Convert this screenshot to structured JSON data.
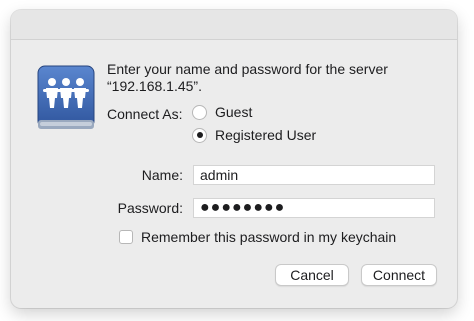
{
  "dialog": {
    "message": "Enter your name and password for the server “192.168.1.45”.",
    "icon": "shared-server-icon",
    "connect_as": {
      "label": "Connect As:",
      "options": [
        {
          "label": "Guest",
          "selected": false
        },
        {
          "label": "Registered User",
          "selected": true
        }
      ]
    },
    "name": {
      "label": "Name:",
      "value": "admin"
    },
    "password": {
      "label": "Password:",
      "value": "●●●●●●●●"
    },
    "remember": {
      "label": "Remember this password in my keychain",
      "checked": false
    },
    "buttons": {
      "cancel": "Cancel",
      "connect": "Connect"
    }
  },
  "colors": {
    "dialog_bg": "#ececec",
    "icon_blue": "#3d67b0"
  }
}
